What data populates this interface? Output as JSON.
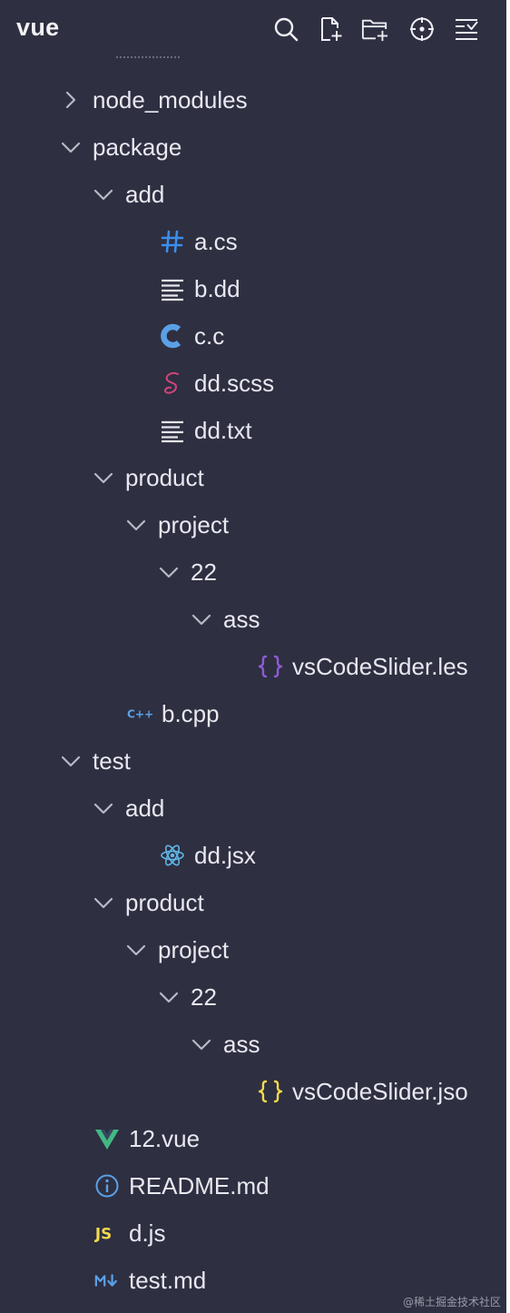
{
  "explorer": {
    "title": "vue",
    "actions": [
      {
        "name": "search-button",
        "icon": "search-icon"
      },
      {
        "name": "new-file-button",
        "icon": "new-file-icon"
      },
      {
        "name": "new-folder-button",
        "icon": "new-folder-icon"
      },
      {
        "name": "locate-file-button",
        "icon": "crosshair-icon"
      },
      {
        "name": "collapse-all-button",
        "icon": "collapse-list-icon"
      }
    ]
  },
  "tree": [
    {
      "label": "node_modules",
      "kind": "folder",
      "expanded": false,
      "depth": 0
    },
    {
      "label": "package",
      "kind": "folder",
      "expanded": true,
      "depth": 0
    },
    {
      "label": "add",
      "kind": "folder",
      "expanded": true,
      "depth": 1
    },
    {
      "label": "a.cs",
      "kind": "file",
      "icon": "csharp-hash-icon",
      "depth": 2
    },
    {
      "label": "b.dd",
      "kind": "file",
      "icon": "text-lines-icon",
      "depth": 2
    },
    {
      "label": "c.c",
      "kind": "file",
      "icon": "c-language-icon",
      "depth": 2
    },
    {
      "label": "dd.scss",
      "kind": "file",
      "icon": "sass-icon",
      "depth": 2
    },
    {
      "label": "dd.txt",
      "kind": "file",
      "icon": "text-lines-icon",
      "depth": 2
    },
    {
      "label": "product",
      "kind": "folder",
      "expanded": true,
      "depth": 1
    },
    {
      "label": "project",
      "kind": "folder",
      "expanded": true,
      "depth": 2
    },
    {
      "label": "22",
      "kind": "folder",
      "expanded": true,
      "depth": 3
    },
    {
      "label": "ass",
      "kind": "folder",
      "expanded": true,
      "depth": 4
    },
    {
      "label": "vsCodeSlider.les",
      "kind": "file",
      "icon": "less-braces-icon",
      "depth": 5
    },
    {
      "label": "b.cpp",
      "kind": "file",
      "icon": "cpp-icon",
      "depth": 1
    },
    {
      "label": "test",
      "kind": "folder",
      "expanded": true,
      "depth": 0
    },
    {
      "label": "add",
      "kind": "folder",
      "expanded": true,
      "depth": 1
    },
    {
      "label": "dd.jsx",
      "kind": "file",
      "icon": "react-icon",
      "depth": 2
    },
    {
      "label": "product",
      "kind": "folder",
      "expanded": true,
      "depth": 1
    },
    {
      "label": "project",
      "kind": "folder",
      "expanded": true,
      "depth": 2
    },
    {
      "label": "22",
      "kind": "folder",
      "expanded": true,
      "depth": 3
    },
    {
      "label": "ass",
      "kind": "folder",
      "expanded": true,
      "depth": 4
    },
    {
      "label": "vsCodeSlider.jso",
      "kind": "file",
      "icon": "json-braces-icon",
      "depth": 5
    },
    {
      "label": "12.vue",
      "kind": "file",
      "icon": "vue-icon",
      "depth": 0
    },
    {
      "label": "README.md",
      "kind": "file",
      "icon": "info-icon",
      "depth": 0
    },
    {
      "label": "d.js",
      "kind": "file",
      "icon": "javascript-icon",
      "depth": 0
    },
    {
      "label": "test.md",
      "kind": "file",
      "icon": "markdown-icon",
      "depth": 0
    }
  ],
  "icon_text": {
    "javascript-icon": "JS",
    "cpp-icon": "C++"
  },
  "colors": {
    "background": "#2e2f41",
    "text": "#e8e8f0",
    "chevron": "#b8b9c6",
    "csharp": "#3b8eea",
    "c": "#5aa0e6",
    "sass": "#d0457a",
    "less": "#8f5bd8",
    "json": "#f2d94e",
    "react": "#5fb7e6",
    "vue": "#41b883",
    "info": "#5aa0e6",
    "javascript": "#f2d94e",
    "markdown": "#5aa0e6",
    "cpp": "#5aa0e6"
  },
  "watermark": "@稀土掘金技术社区"
}
